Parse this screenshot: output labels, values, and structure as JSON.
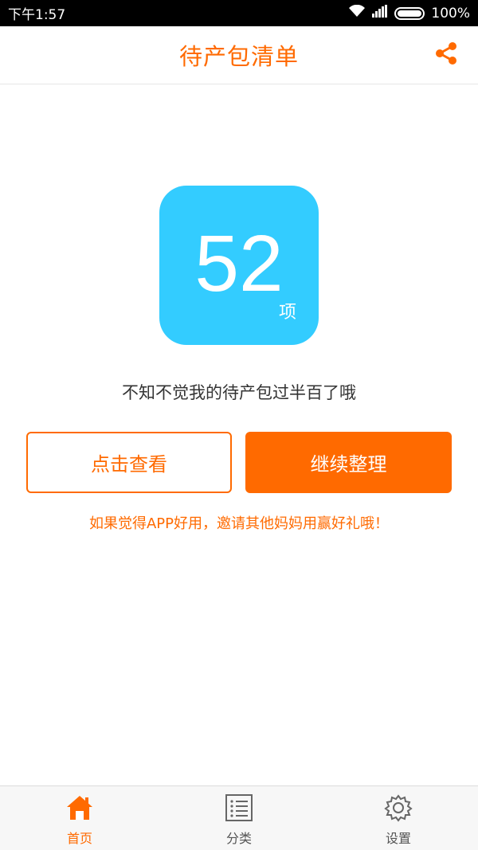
{
  "status_bar": {
    "time": "下午1:57",
    "battery": "100%"
  },
  "header": {
    "title": "待产包清单",
    "share_icon": "share-icon"
  },
  "summary": {
    "count": "52",
    "unit": "项",
    "message": "不知不觉我的待产包过半百了哦"
  },
  "actions": {
    "view_label": "点击查看",
    "continue_label": "继续整理",
    "invite_text": "如果觉得APP好用，邀请其他妈妈用赢好礼哦！"
  },
  "tabs": [
    {
      "label": "首页",
      "icon": "home-icon",
      "active": true
    },
    {
      "label": "分类",
      "icon": "list-icon",
      "active": false
    },
    {
      "label": "设置",
      "icon": "gear-icon",
      "active": false
    }
  ],
  "colors": {
    "accent": "#ff6a00",
    "tile": "#33ccff",
    "status_bar": "#000000"
  }
}
